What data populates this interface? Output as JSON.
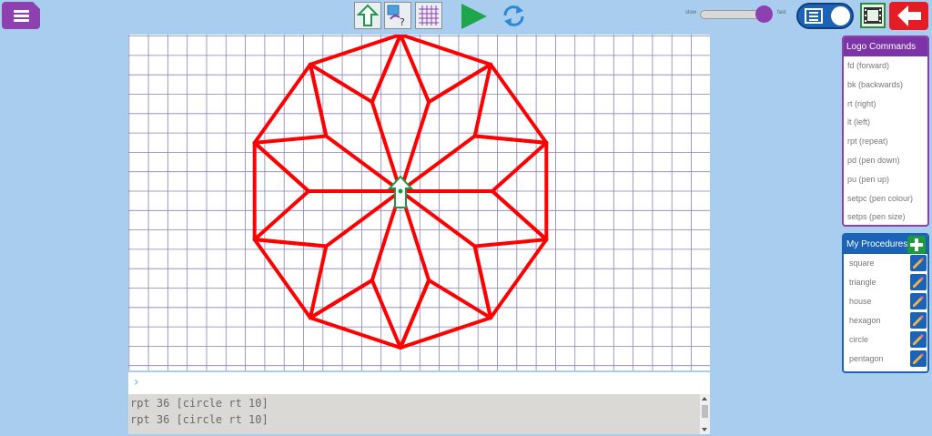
{
  "toolbar": {
    "speed_slow_label": "slow",
    "speed_fast_label": "fast",
    "speed_value": 0.95,
    "icons": [
      "menu-icon",
      "turtle-arrow-icon",
      "shape-help-icon",
      "grid-icon",
      "play-icon",
      "refresh-icon",
      "console-toggle-icon",
      "film-icon",
      "back-arrow-icon"
    ]
  },
  "colors": {
    "accent_purple": "#8e3fb0",
    "accent_blue": "#1a63b6",
    "pen": "#ff0000",
    "turtle": "#1a9a4a",
    "back": "#e51c24"
  },
  "console": {
    "prompt": "›",
    "history": [
      "rpt 36 [circle rt 10]",
      "rpt 36 [circle rt 10]"
    ]
  },
  "commands": {
    "title": "Logo Commands",
    "items": [
      "fd (forward)",
      "bk (backwards)",
      "rt (right)",
      "lt (left)",
      "rpt (repeat)",
      "pd (pen down)",
      "pu (pen up)",
      "setpc (pen colour)",
      "setps (pen size)"
    ]
  },
  "procedures": {
    "title": "My Procedures",
    "items": [
      "square",
      "triangle",
      "house",
      "hexagon",
      "circle",
      "pentagon"
    ]
  }
}
